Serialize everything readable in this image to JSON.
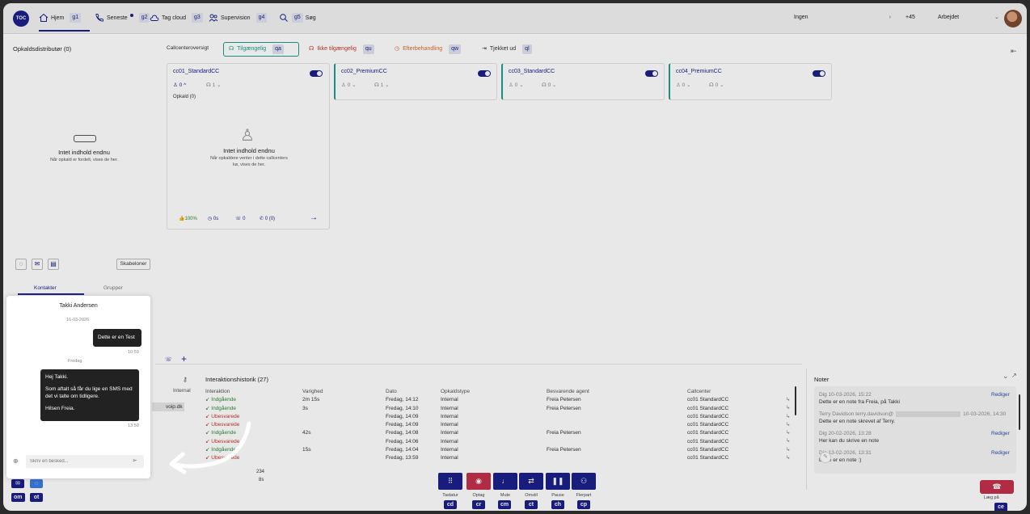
{
  "logo": "TOC",
  "nav": [
    {
      "label": "Hjem",
      "key": "g1"
    },
    {
      "label": "Seneste",
      "key": "g2"
    },
    {
      "label": "Tag cloud",
      "key": "g3"
    },
    {
      "label": "Supervision",
      "key": "g4"
    },
    {
      "label": "Søg",
      "key": "g5"
    }
  ],
  "top_right": {
    "status_select": "Ingen",
    "phone": "+45",
    "work_status": "Arbejdet"
  },
  "left_panel": {
    "title": "Opkaldsdistributør (0)",
    "empty_title": "Intet indhold endnu",
    "empty_sub": "Når opkald er fordelt, vises de her.",
    "templates_btn": "Skabeloner",
    "tab_contacts": "Kontakter",
    "tab_groups": "Grupper"
  },
  "callcenter": {
    "label": "Callcenteroversigt",
    "filters": [
      {
        "label": "Tilgængelig",
        "key": "qa",
        "color": "#1f9b8a"
      },
      {
        "label": "Ikke tilgængelig",
        "key": "qu",
        "color": "#c0392b"
      },
      {
        "label": "Efterbehandling",
        "key": "qw",
        "color": "#e06a2c"
      },
      {
        "label": "Tjekket ud",
        "key": "ql",
        "color": "#333333"
      }
    ],
    "cards": [
      {
        "name": "cc01_StandardCC",
        "agents": "0",
        "queue": "1"
      },
      {
        "name": "cc02_PremiumCC",
        "agents": "0",
        "queue": "1"
      },
      {
        "name": "cc03_StandardCC",
        "agents": "0",
        "queue": "0"
      },
      {
        "name": "cc04_PremiumCC",
        "agents": "0",
        "queue": "0"
      }
    ],
    "calls_label": "Opkald (0)",
    "empty_title": "Intet indhold endnu",
    "empty_sub": "Når opkaldere venter i dette callcenters kø, vises de her.",
    "stats": {
      "sla": "100%",
      "wait": "0s",
      "calls": "0",
      "missed": "0 (0)"
    }
  },
  "chat": {
    "contact": "Takki Andersen",
    "date1": "16-03-2026",
    "msg_out": "Dette er en Test",
    "time_out": "10:59",
    "date2": "Fredag",
    "msg_in_1": "Hej Takki.",
    "msg_in_2": "Som aftalt så får du lige en SMS med det vi talte om tidligere.",
    "msg_in_3": "Hilsen Freia.",
    "time_in": "13:50",
    "placeholder": "Skriv en besked..."
  },
  "history": {
    "title": "Interaktionshistorik (27)",
    "internal_label": "Internal",
    "domain_frag": "voip.dk",
    "headers": [
      "Interaktion",
      "Varighed",
      "Dato",
      "Opkaldstype",
      "Besvarende agent",
      "Callcenter"
    ],
    "rows": [
      {
        "type": "Indgående",
        "dur": "2m 15s",
        "date": "Fredag, 14:12",
        "kind": "Internal",
        "agent": "Freia Petersen",
        "cc": "cc01 StandardCC",
        "missed": false
      },
      {
        "type": "Indgående",
        "dur": "3s",
        "date": "Fredag, 14:10",
        "kind": "Internal",
        "agent": "Freia Petersen",
        "cc": "cc01 StandardCC",
        "missed": false
      },
      {
        "type": "Ubesvarede",
        "dur": "",
        "date": "Fredag, 14:09",
        "kind": "Internal",
        "agent": "",
        "cc": "cc01 StandardCC",
        "missed": true
      },
      {
        "type": "Ubesvarede",
        "dur": "",
        "date": "Fredag, 14:09",
        "kind": "Internal",
        "agent": "",
        "cc": "cc01 StandardCC",
        "missed": true
      },
      {
        "type": "Indgående",
        "dur": "42s",
        "date": "Fredag, 14:08",
        "kind": "Internal",
        "agent": "Freia Petersen",
        "cc": "cc01 StandardCC",
        "missed": false
      },
      {
        "type": "Ubesvarede",
        "dur": "",
        "date": "Fredag, 14:06",
        "kind": "Internal",
        "agent": "",
        "cc": "cc01 StandardCC",
        "missed": true
      },
      {
        "type": "Indgående",
        "dur": "15s",
        "date": "Fredag, 14:04",
        "kind": "Internal",
        "agent": "Freia Petersen",
        "cc": "cc01 StandardCC",
        "missed": false
      },
      {
        "type": "Ubesvarede",
        "dur": "",
        "date": "Fredag, 13:59",
        "kind": "Internal",
        "agent": "",
        "cc": "cc01 StandardCC",
        "missed": true
      }
    ],
    "footer_count": "234",
    "footer_dur": "8s"
  },
  "notes": {
    "title": "Noter",
    "edit_label": "Rediger",
    "items": [
      {
        "meta": "Dig 10-03-2026, 15:22",
        "text": "Dette er en note fra Freia, på Takki",
        "editable": true
      },
      {
        "meta": "Terry Davidson terry.davidson@",
        "meta2": "10-03-2026, 14:30",
        "text": "Dette er en note skrevet af Terry.",
        "editable": false
      },
      {
        "meta": "Dig 20-02-2026, 13:28",
        "text": "Her kan du skrive en note",
        "editable": true
      },
      {
        "meta": "Dig 13-02-2026, 13:31",
        "text": "Dette er en note :)",
        "editable": true
      }
    ]
  },
  "controls": [
    {
      "label": "Tastatur",
      "key": "cd"
    },
    {
      "label": "Optag",
      "key": "cr"
    },
    {
      "label": "Mute",
      "key": "cm"
    },
    {
      "label": "Omstil",
      "key": "ct"
    },
    {
      "label": "Pause",
      "key": "ch"
    },
    {
      "label": "Flerpart",
      "key": "cp"
    }
  ],
  "hangup": {
    "label": "Læg på",
    "key": "ce"
  },
  "bottom_keys": {
    "k1": "om",
    "k2": "ot"
  }
}
